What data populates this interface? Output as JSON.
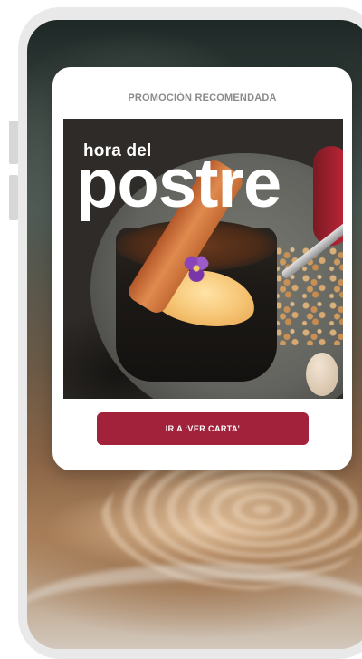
{
  "promo": {
    "header": "PROMOCIÓN RECOMENDADA",
    "image": {
      "title_small": "hora del",
      "title_big": "postre"
    },
    "cta_label": "IR A ‘VER CARTA’"
  },
  "colors": {
    "accent": "#a1223a",
    "card_bg": "#ffffff",
    "header_text": "#8a8a8a",
    "frame": "#e9e9e9"
  }
}
